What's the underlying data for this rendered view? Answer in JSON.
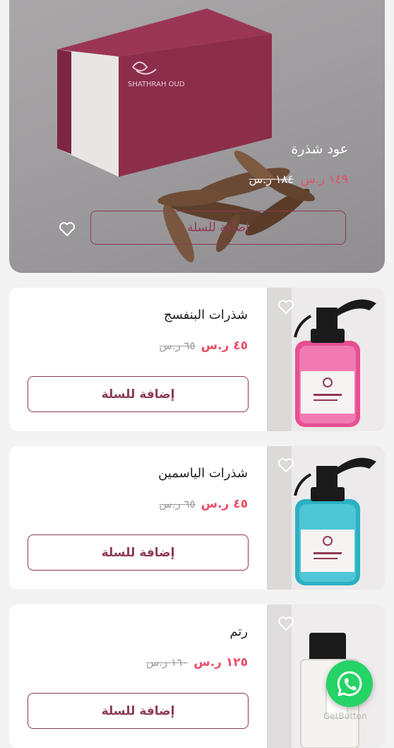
{
  "featured": {
    "name": "عود شذرة",
    "price": "١٤٩ ر.س",
    "old_price": "١٨٤ ر.س",
    "add_label": "إضافة للسلة",
    "icons": {
      "wishlist": "heart-outline-icon"
    }
  },
  "products": [
    {
      "name": "شذرات البنفسج",
      "price": "٤٥ ر.س",
      "old_price": "٦٥ ر.س",
      "add_label": "إضافة للسلة"
    },
    {
      "name": "شذرات الياسمين",
      "price": "٤٥ ر.س",
      "old_price": "٦٥ ر.س",
      "add_label": "إضافة للسلة"
    },
    {
      "name": "رتم",
      "price": "١٢٥ ر.س",
      "old_price": "١٦٠ ر.س",
      "add_label": "إضافة للسلة"
    }
  ],
  "whatsapp": {
    "icon": "whatsapp-icon",
    "watermark": "GetButton"
  },
  "colors": {
    "accent": "#8d3b53",
    "sale_price": "#e94d68",
    "whatsapp": "#25d366"
  }
}
